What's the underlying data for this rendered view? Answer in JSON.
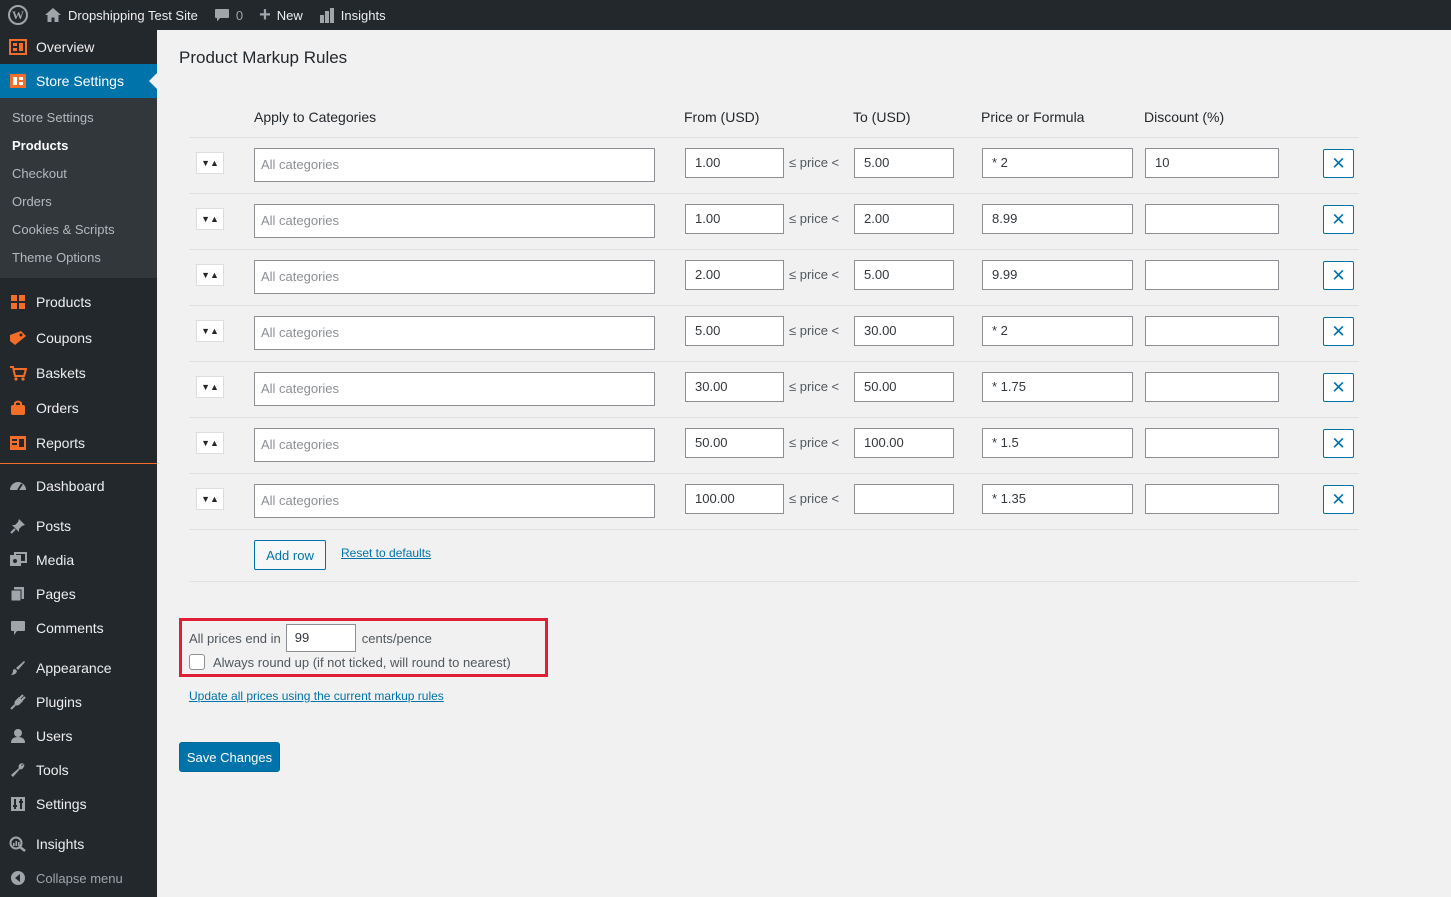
{
  "adminbar": {
    "site_name": "Dropshipping Test Site",
    "comments_count": "0",
    "new_label": "New",
    "insights_label": "Insights"
  },
  "sidebar": {
    "top_items": [
      {
        "label": "Overview",
        "icon": "overview-icon"
      },
      {
        "label": "Store Settings",
        "icon": "store-settings-icon"
      }
    ],
    "submenu": [
      "Store Settings",
      "Products",
      "Checkout",
      "Orders",
      "Cookies & Scripts",
      "Theme Options"
    ],
    "submenu_active": "Products",
    "store_items": [
      {
        "label": "Products",
        "icon": "grid-icon"
      },
      {
        "label": "Coupons",
        "icon": "coupon-icon"
      },
      {
        "label": "Baskets",
        "icon": "cart-icon"
      },
      {
        "label": "Orders",
        "icon": "bag-icon"
      },
      {
        "label": "Reports",
        "icon": "reports-icon"
      }
    ],
    "wp_items": [
      {
        "label": "Dashboard",
        "icon": "dashboard-icon"
      },
      {
        "label": "Posts",
        "icon": "pin-icon"
      },
      {
        "label": "Media",
        "icon": "media-icon"
      },
      {
        "label": "Pages",
        "icon": "pages-icon"
      },
      {
        "label": "Comments",
        "icon": "comment-icon"
      },
      {
        "label": "Appearance",
        "icon": "brush-icon"
      },
      {
        "label": "Plugins",
        "icon": "plug-icon"
      },
      {
        "label": "Users",
        "icon": "user-icon"
      },
      {
        "label": "Tools",
        "icon": "wrench-icon"
      },
      {
        "label": "Settings",
        "icon": "settings-icon"
      },
      {
        "label": "Insights",
        "icon": "insights-icon"
      }
    ],
    "collapse_label": "Collapse menu"
  },
  "page": {
    "title": "Product Markup Rules"
  },
  "rules": {
    "headers": {
      "categories": "Apply to Categories",
      "from": "From (USD)",
      "to": "To (USD)",
      "price": "Price or Formula",
      "discount": "Discount (%)"
    },
    "between_label": "≤ price <",
    "rows": [
      {
        "category": "All categories",
        "from": "1.00",
        "to": "5.00",
        "price": "* 2",
        "discount": "10"
      },
      {
        "category": "All categories",
        "from": "1.00",
        "to": "2.00",
        "price": "8.99",
        "discount": ""
      },
      {
        "category": "All categories",
        "from": "2.00",
        "to": "5.00",
        "price": "9.99",
        "discount": ""
      },
      {
        "category": "All categories",
        "from": "5.00",
        "to": "30.00",
        "price": "* 2",
        "discount": ""
      },
      {
        "category": "All categories",
        "from": "30.00",
        "to": "50.00",
        "price": "* 1.75",
        "discount": ""
      },
      {
        "category": "All categories",
        "from": "50.00",
        "to": "100.00",
        "price": "* 1.5",
        "discount": ""
      },
      {
        "category": "All categories",
        "from": "100.00",
        "to": "",
        "price": "* 1.35",
        "discount": ""
      }
    ],
    "add_row_label": "Add row",
    "reset_label": "Reset to defaults"
  },
  "rounding": {
    "prefix": "All prices end in",
    "value": "99",
    "suffix": "cents/pence",
    "round_up_label": "Always round up (if not ticked, will round to nearest)",
    "round_up_checked": false
  },
  "update_link": "Update all prices using the current markup rules",
  "save_label": "Save Changes"
}
